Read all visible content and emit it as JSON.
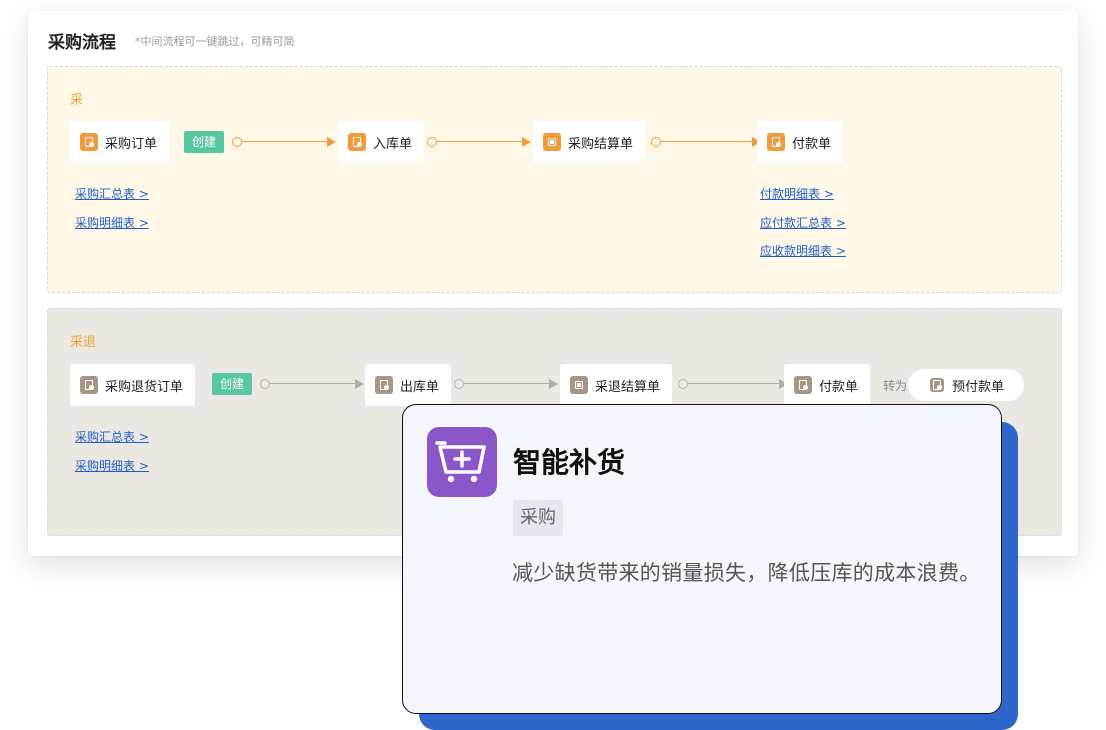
{
  "panel": {
    "title": "采购流程",
    "note": "*中间流程可一键跳过，可精可简"
  },
  "purchase": {
    "label": "采",
    "nodes": [
      {
        "label": "采购订单",
        "icon": "document-icon"
      },
      {
        "label": "入库单",
        "icon": "document-icon"
      },
      {
        "label": "采购结算单",
        "icon": "box-icon"
      },
      {
        "label": "付款单",
        "icon": "document-icon"
      }
    ],
    "create_tag": "创建",
    "links_left": [
      "采购汇总表 >",
      "采购明细表 >"
    ],
    "links_right": [
      "付款明细表 >",
      "应付款汇总表 >",
      "应收款明细表 >"
    ]
  },
  "return": {
    "label": "采退",
    "nodes": [
      {
        "label": "采购退货订单",
        "icon": "document-icon"
      },
      {
        "label": "出库单",
        "icon": "document-icon"
      },
      {
        "label": "采退结算单",
        "icon": "box-icon"
      },
      {
        "label": "付款单",
        "icon": "document-icon"
      }
    ],
    "create_tag": "创建",
    "convert_label": "转为",
    "prepay_node": "预付款单",
    "links_left": [
      "采购汇总表 >",
      "采购明细表 >"
    ]
  },
  "card": {
    "icon": "shopping-cart-plus-icon",
    "title": "智能补货",
    "tag": "采购",
    "description": "减少缺货带来的销量损失，降低压库的成本浪费。"
  },
  "colors": {
    "accent_orange": "#f29b3c",
    "icon_orange": "#f39a3a",
    "icon_brown": "#a79585",
    "tag_green": "#57c7a0",
    "link_blue": "#1f5fc4",
    "card_purple": "#8a56c8",
    "card_shadow_blue": "#2e66cc"
  }
}
